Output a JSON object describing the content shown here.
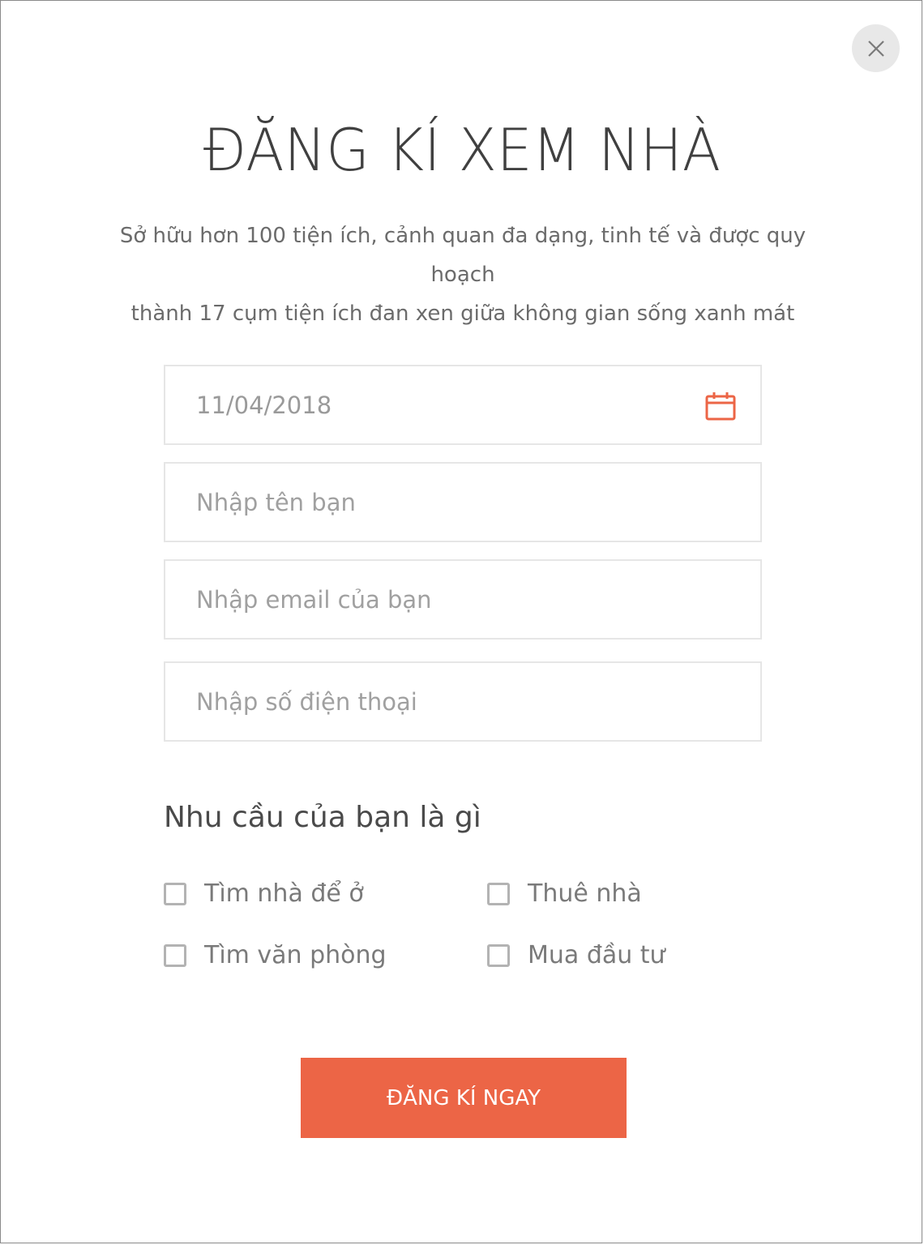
{
  "modal": {
    "title": "ĐĂNG KÍ XEM NHÀ",
    "subtitle_line1": "Sở hữu hơn 100 tiện ích, cảnh quan đa dạng, tinh tế và được quy hoạch",
    "subtitle_line2": "thành 17 cụm tiện ích đan xen giữa không gian sống xanh mát"
  },
  "form": {
    "date_value": "11/04/2018",
    "name_placeholder": "Nhập tên bạn",
    "email_placeholder": "Nhập email của bạn",
    "phone_placeholder": "Nhập số điện thoại",
    "needs_title": "Nhu cầu của bạn là gì",
    "options": [
      {
        "label": "Tìm nhà để ở",
        "checked": false
      },
      {
        "label": "Thuê nhà",
        "checked": false
      },
      {
        "label": "Tìm văn phòng",
        "checked": false
      },
      {
        "label": "Mua đầu tư",
        "checked": false
      }
    ],
    "submit_label": "ĐĂNG KÍ NGAY"
  },
  "icons": {
    "close": "close-icon",
    "calendar": "calendar-icon"
  },
  "colors": {
    "accent": "#ec6546",
    "close_bg": "#e8e8e8",
    "field_border": "#e6e6e6"
  }
}
